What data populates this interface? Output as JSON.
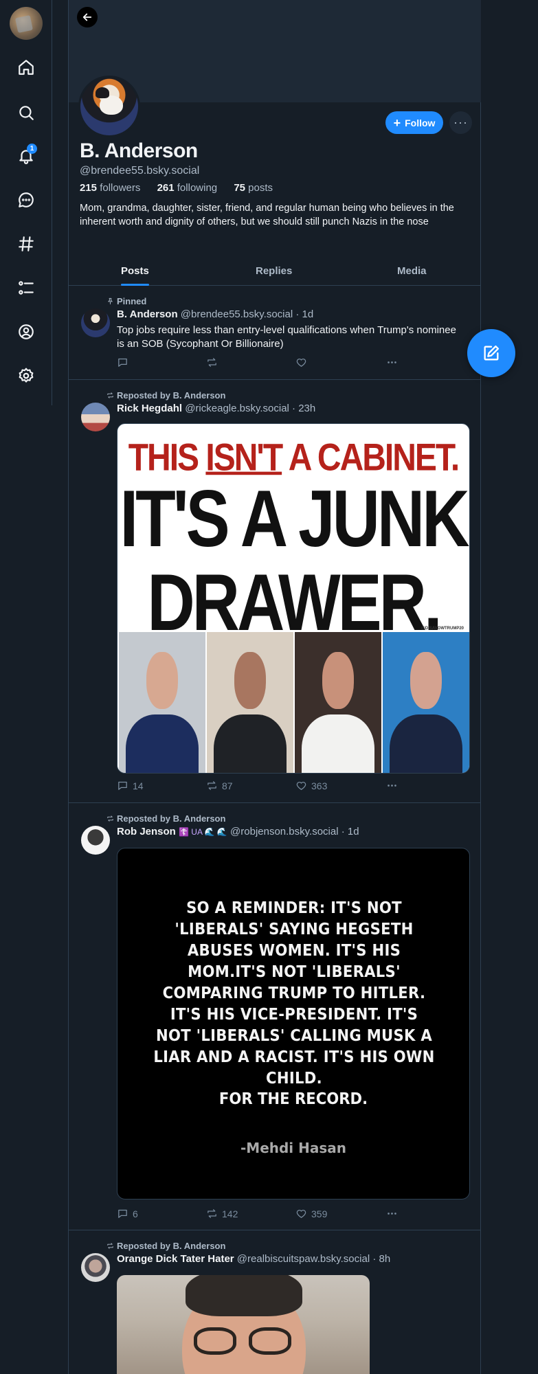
{
  "nav": {
    "items": [
      {
        "name": "home",
        "icon": "home-icon"
      },
      {
        "name": "search",
        "icon": "search-icon"
      },
      {
        "name": "notifications",
        "icon": "bell-icon",
        "badge": "1"
      },
      {
        "name": "chat",
        "icon": "chat-icon"
      },
      {
        "name": "feeds",
        "icon": "hashtag-icon"
      },
      {
        "name": "lists",
        "icon": "list-icon"
      },
      {
        "name": "profile",
        "icon": "user-circle-icon"
      },
      {
        "name": "settings",
        "icon": "gear-icon"
      }
    ]
  },
  "profile": {
    "display_name": "B. Anderson",
    "handle": "@brendee55.bsky.social",
    "followers_count": "215",
    "followers_label": "followers",
    "following_count": "261",
    "following_label": "following",
    "posts_count": "75",
    "posts_label": "posts",
    "bio": "Mom, grandma, daughter, sister, friend, and regular human being who believes in the inherent worth and dignity of others, but we should still punch Nazis in the nose",
    "follow_label": "Follow",
    "more_label": "···"
  },
  "tabs": [
    "Posts",
    "Replies",
    "Media"
  ],
  "colors": {
    "accent": "#208bfe",
    "background": "#161e27",
    "muted": "#aebbc9"
  },
  "posts": [
    {
      "reason": "Pinned",
      "author": "B. Anderson",
      "handle": "@brendee55.bsky.social",
      "time": "· 1d",
      "text": "Top jobs require less than entry-level qualifications when Trump's nominee is an SOB (Sycophant Or Billionaire)",
      "replies": "",
      "reposts": "",
      "likes": ""
    },
    {
      "reason": "Reposted by B. Anderson",
      "author": "Rick Hegdahl",
      "handle": "@rickeagle.bsky.social",
      "time": "· 23h",
      "image": {
        "line1_a": "THIS ",
        "line1_b": "ISN'T",
        "line1_c": " A CABINET.",
        "line2": "IT'S A JUNK",
        "line3": "DRAWER.",
        "credit": "@DISAVOWTRUMP20"
      },
      "replies": "14",
      "reposts": "87",
      "likes": "363"
    },
    {
      "reason": "Reposted by B. Anderson",
      "author": "Rob Jenson",
      "author_emoji": "☦️ UA 🌊 🌊",
      "handle": "@robjenson.bsky.social",
      "time": "· 1d",
      "image": {
        "quote": "SO A REMINDER: IT'S NOT 'LIBERALS' SAYING HEGSETH ABUSES WOMEN. IT'S HIS MOM.IT'S NOT 'LIBERALS' COMPARING TRUMP TO HITLER. IT'S HIS VICE-PRESIDENT. IT'S NOT 'LIBERALS' CALLING MUSK A LIAR AND A RACIST. IT'S HIS OWN CHILD.",
        "record": "FOR THE RECORD.",
        "author": "-Mehdi Hasan"
      },
      "replies": "6",
      "reposts": "142",
      "likes": "359"
    },
    {
      "reason": "Reposted by B. Anderson",
      "author": "Orange Dick Tater Hater",
      "handle": "@realbiscuitspaw.bsky.social",
      "time": "· 8h"
    }
  ]
}
